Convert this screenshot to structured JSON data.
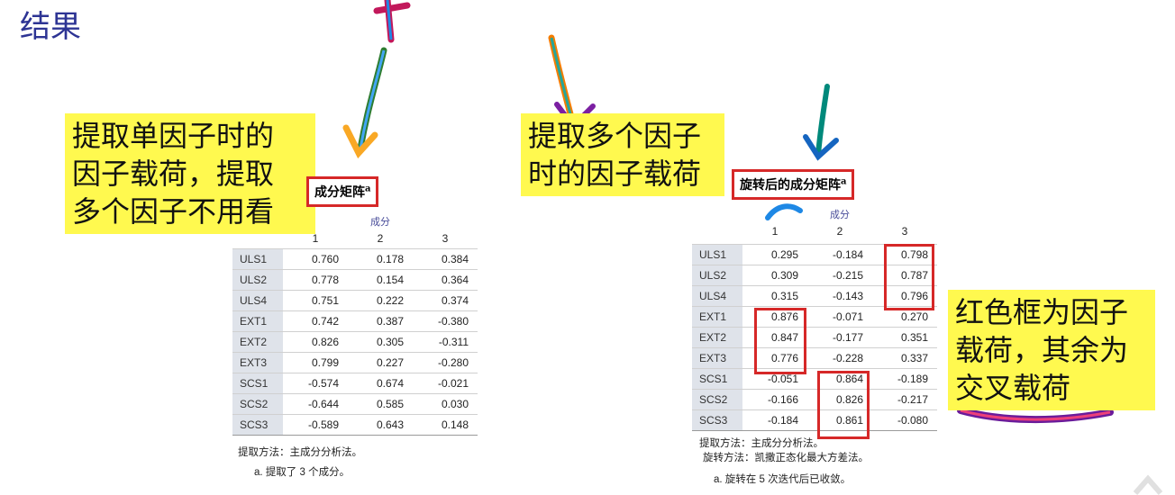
{
  "slide_title": "结果",
  "notes": {
    "left": [
      "提取单因子时的",
      "因子载荷，提取",
      "多个因子不用看"
    ],
    "middle": [
      "提取多个因子",
      "时的因子载荷"
    ],
    "right": [
      "红色框为因子",
      "载荷，其余为",
      "交叉载荷"
    ]
  },
  "left_table": {
    "caption": "成分矩阵",
    "caption_sup": "a",
    "component_header": "成分",
    "columns": [
      "1",
      "2",
      "3"
    ],
    "rows": [
      {
        "label": "ULS1",
        "values": [
          "0.760",
          "0.178",
          "0.384"
        ]
      },
      {
        "label": "ULS2",
        "values": [
          "0.778",
          "0.154",
          "0.364"
        ]
      },
      {
        "label": "ULS4",
        "values": [
          "0.751",
          "0.222",
          "0.374"
        ]
      },
      {
        "label": "EXT1",
        "values": [
          "0.742",
          "0.387",
          "-0.380"
        ]
      },
      {
        "label": "EXT2",
        "values": [
          "0.826",
          "0.305",
          "-0.311"
        ]
      },
      {
        "label": "EXT3",
        "values": [
          "0.799",
          "0.227",
          "-0.280"
        ]
      },
      {
        "label": "SCS1",
        "values": [
          "-0.574",
          "0.674",
          "-0.021"
        ]
      },
      {
        "label": "SCS2",
        "values": [
          "-0.644",
          "0.585",
          "0.030"
        ]
      },
      {
        "label": "SCS3",
        "values": [
          "-0.589",
          "0.643",
          "0.148"
        ]
      }
    ],
    "footnotes": [
      "提取方法：主成分分析法。",
      "a. 提取了 3 个成分。"
    ]
  },
  "right_table": {
    "caption": "旋转后的成分矩阵",
    "caption_sup": "a",
    "component_header": "成分",
    "columns": [
      "1",
      "2",
      "3"
    ],
    "rows": [
      {
        "label": "ULS1",
        "values": [
          "0.295",
          "-0.184",
          "0.798"
        ]
      },
      {
        "label": "ULS2",
        "values": [
          "0.309",
          "-0.215",
          "0.787"
        ]
      },
      {
        "label": "ULS4",
        "values": [
          "0.315",
          "-0.143",
          "0.796"
        ]
      },
      {
        "label": "EXT1",
        "values": [
          "0.876",
          "-0.071",
          "0.270"
        ]
      },
      {
        "label": "EXT2",
        "values": [
          "0.847",
          "-0.177",
          "0.351"
        ]
      },
      {
        "label": "EXT3",
        "values": [
          "0.776",
          "-0.228",
          "0.337"
        ]
      },
      {
        "label": "SCS1",
        "values": [
          "-0.051",
          "0.864",
          "-0.189"
        ]
      },
      {
        "label": "SCS2",
        "values": [
          "-0.166",
          "0.826",
          "-0.217"
        ]
      },
      {
        "label": "SCS3",
        "values": [
          "-0.184",
          "0.861",
          "-0.080"
        ]
      }
    ],
    "footnotes": [
      "提取方法：主成分分析法。",
      "旋转方法：凯撒正态化最大方差法。",
      "a. 旋转在 5 次迭代后已收敛。"
    ]
  },
  "colors": {
    "title": "#2d3494",
    "highlight": "#fff94f",
    "box": "#d62828",
    "row_label_bg": "#dfe3ea"
  }
}
